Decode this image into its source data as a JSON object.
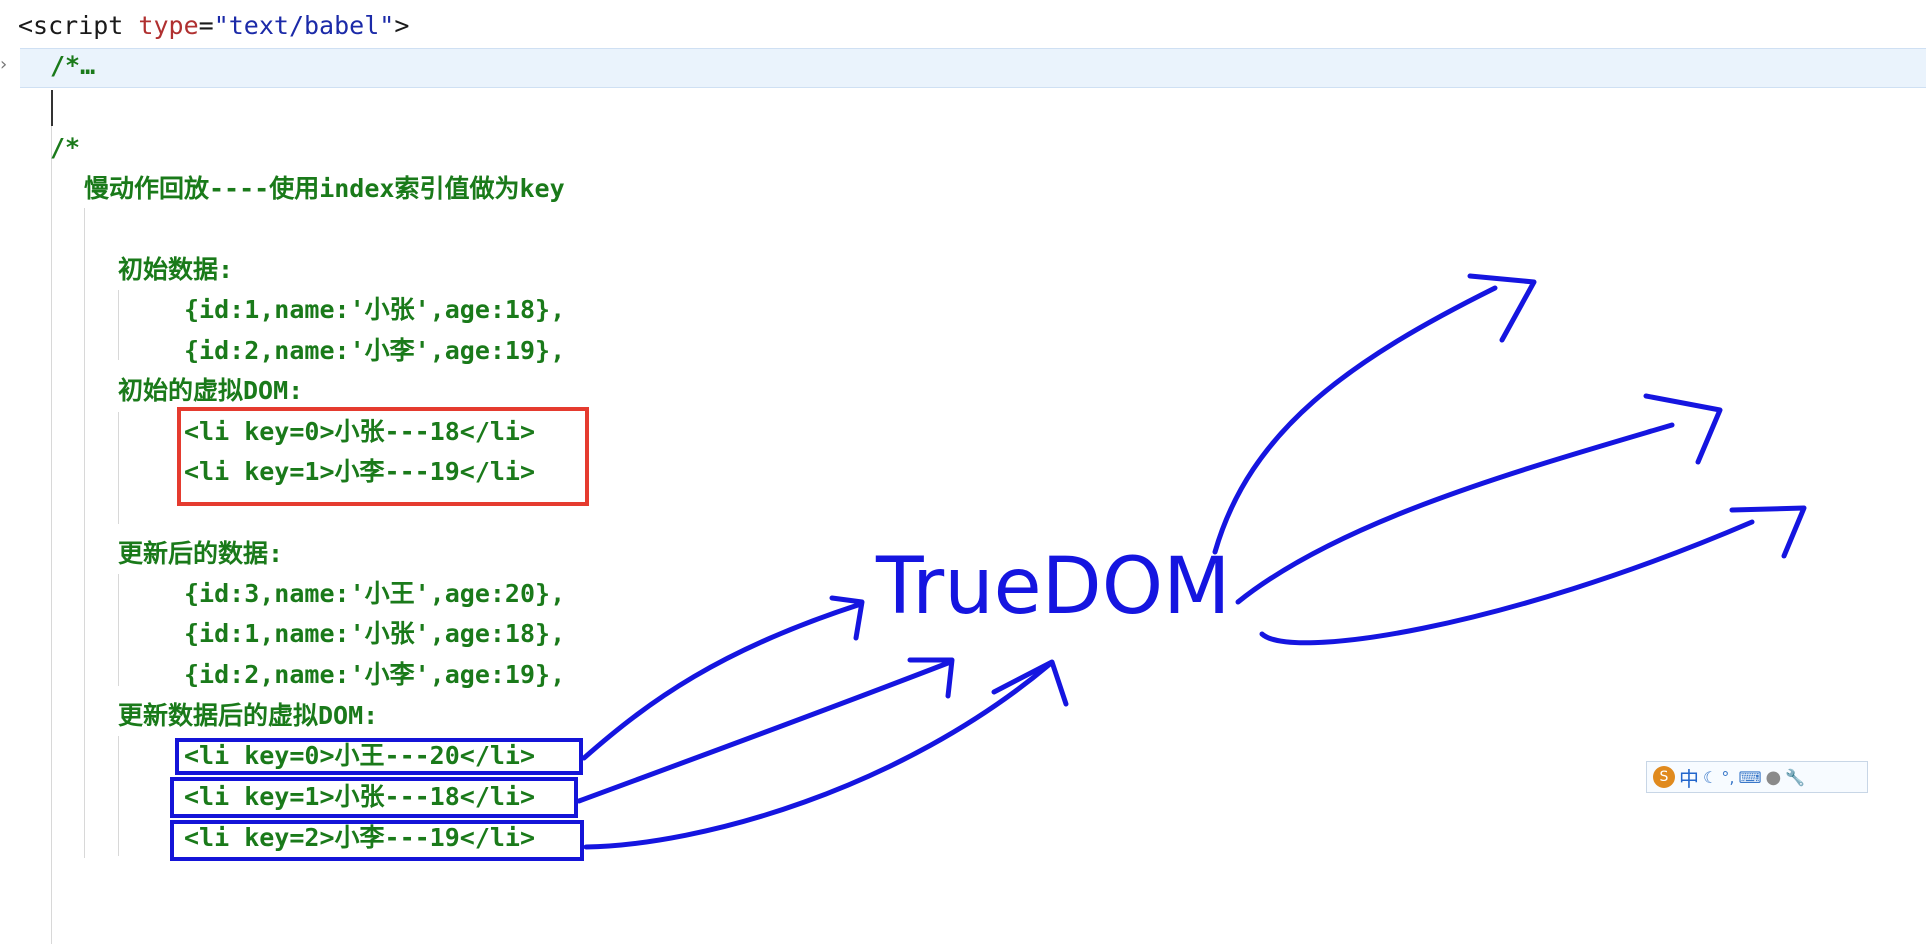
{
  "editor": {
    "script_tag": {
      "open": "<script",
      "attr": "type",
      "eq": "=",
      "value": "\"text/babel\"",
      "close": ">"
    },
    "collapsed_comment": "/*…",
    "comment_open": "/*",
    "heading": "慢动作回放----使用index索引值做为key",
    "initial_data_label": "初始数据:",
    "initial_data": [
      "{id:1,name:'小张',age:18},",
      "{id:2,name:'小李',age:19},"
    ],
    "initial_vdom_label": "初始的虚拟DOM:",
    "initial_vdom": [
      "<li key=0>小张---18</li>",
      "<li key=1>小李---19</li>"
    ],
    "updated_data_label": "更新后的数据:",
    "updated_data": [
      "{id:3,name:'小王',age:20},",
      "{id:1,name:'小张',age:18},",
      "{id:2,name:'小李',age:19},"
    ],
    "updated_vdom_label": "更新数据后的虚拟DOM:",
    "updated_vdom": [
      "<li key=0>小王---20</li>",
      "<li key=1>小张---18</li>",
      "<li key=2>小李---19</li>"
    ]
  },
  "annotation": {
    "label": "TrueDOM",
    "ink_color": "#1515e0",
    "highlight_red": "#e53b2f",
    "highlight_blue": "#1414d8"
  },
  "ime_toolbar": {
    "logo_icon": "sogou-logo-icon",
    "mode": "中",
    "icons": [
      "moon-icon",
      "punctuation-icon",
      "keyboard-icon",
      "user-icon",
      "wrench-icon"
    ]
  }
}
